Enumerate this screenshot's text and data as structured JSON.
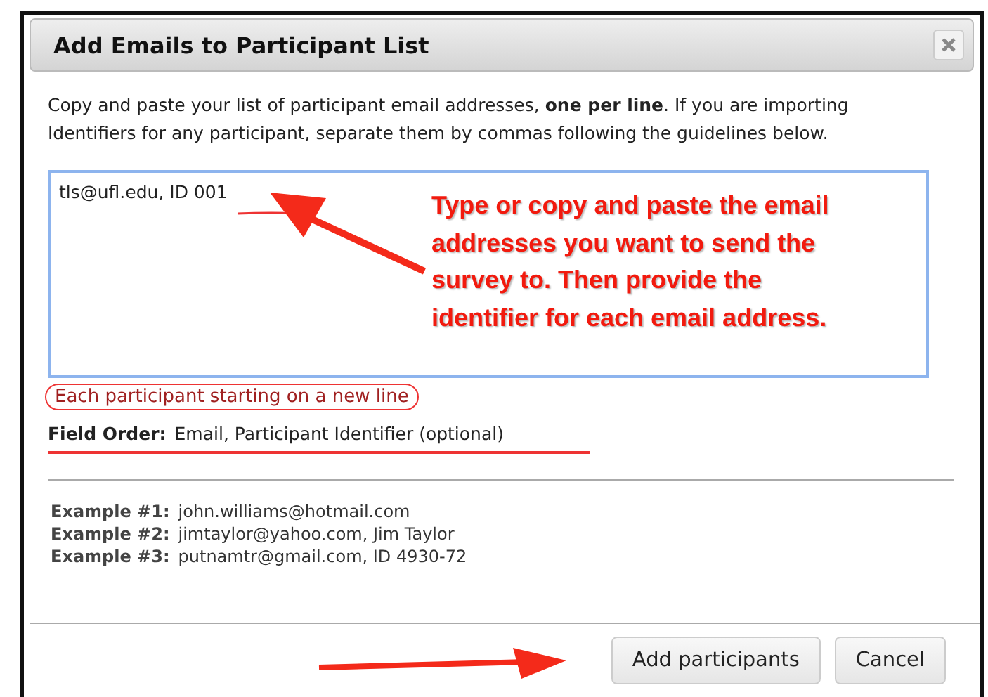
{
  "dialog": {
    "title": "Add Emails to Participant List"
  },
  "intro": "Copy and paste your list of participant email addresses, **one per line**. If you are importing Identifiers for any participant, separate them by commas following the guidelines below.",
  "emails_field": {
    "value": "tls@ufl.edu, ID 001"
  },
  "annotation": {
    "text": "Type or copy and paste the email addresses you want to send the survey to. Then provide the identifier for each email address."
  },
  "circled_note": "Each participant starting on a new line",
  "field_order": {
    "label": "Field Order:",
    "value": "Email, Participant Identifier (optional)"
  },
  "examples": [
    {
      "label": "Example #1:",
      "value": "john.williams@hotmail.com"
    },
    {
      "label": "Example #2:",
      "value": "jimtaylor@yahoo.com, Jim Taylor"
    },
    {
      "label": "Example #3:",
      "value": "putnamtr@gmail.com, ID 4930-72"
    }
  ],
  "buttons": [
    {
      "label": "Add participants"
    },
    {
      "label": "Cancel"
    }
  ]
}
